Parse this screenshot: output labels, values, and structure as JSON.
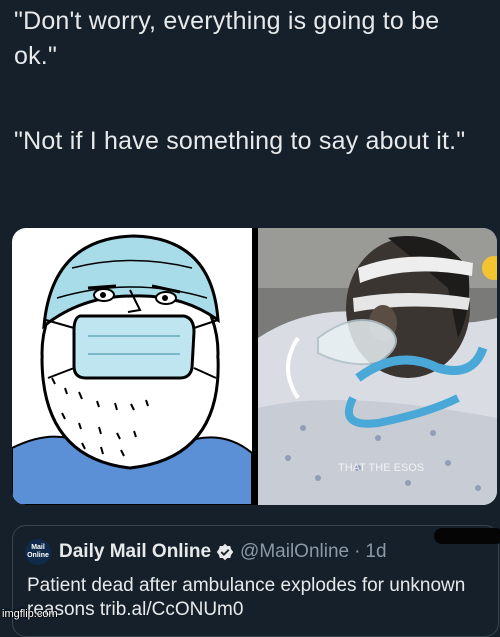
{
  "quotes": [
    "\"Don't worry, everything is going to be ok.\"",
    "\"Not if I have something to say about it.\""
  ],
  "photo": {
    "overlay_text": "THAT THE ESOS"
  },
  "tweet": {
    "avatar_line1": "Mail",
    "avatar_line2": "Online",
    "display_name": "Daily Mail Online",
    "handle": "@MailOnline",
    "separator": "·",
    "time": "1d",
    "text": "Patient dead after ambulance explodes for unknown reasons trib.al/CcONUm0"
  },
  "watermark": "imgflip.com",
  "colors": {
    "background": "#15202b",
    "text": "#e7e9ea",
    "muted": "#8b98a5",
    "verified": "#1d9bf0",
    "scrubs": "#a8dce8",
    "tube": "#4aa8d8"
  }
}
